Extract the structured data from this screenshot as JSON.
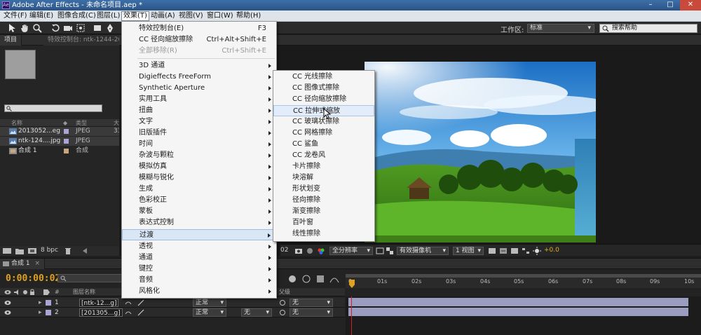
{
  "window": {
    "title": "Adobe After Effects - 未命名项目.aep *",
    "icon_text": "Ae",
    "buttons": [
      "–",
      "□",
      "✕"
    ]
  },
  "menubar": {
    "items": [
      "文件(F)",
      "编辑(E)",
      "图像合成(C)",
      "图层(L)",
      "效果(T)",
      "动画(A)",
      "视图(V)",
      "窗口(W)",
      "帮助(H)"
    ],
    "active_index": 4
  },
  "toolbar": {
    "workspace_label": "工作区:",
    "workspace_value": "标准",
    "search_placeholder": "搜索帮助"
  },
  "project_panel": {
    "tabs": [
      "项目",
      "特效控制台: ntk-1244-267"
    ],
    "columns": [
      "名称",
      "类型",
      "大"
    ],
    "items": [
      {
        "name": "2013052...eg",
        "type": "JPEG",
        "size": "33",
        "color": "#a9a5d6"
      },
      {
        "name": "ntk-124....jpg",
        "type": "JPEG",
        "size": "",
        "color": "#a9a5d6"
      },
      {
        "name": "合成 1",
        "type": "合成",
        "size": "",
        "color": "#c9a67e"
      }
    ],
    "bpc": "8 bpc"
  },
  "effect_menu": {
    "items": [
      {
        "label": "特效控制台(E)",
        "shortcut": "F3",
        "disabled": false,
        "submenu": false
      },
      {
        "label": "CC 径向缩放擦除",
        "shortcut": "Ctrl+Alt+Shift+E",
        "disabled": false,
        "submenu": false
      },
      {
        "label": "全部移除(R)",
        "shortcut": "Ctrl+Shift+E",
        "disabled": true,
        "submenu": false
      },
      {
        "label": "3D 通道",
        "shortcut": "",
        "disabled": false,
        "submenu": true
      },
      {
        "label": "Digieffects FreeForm",
        "shortcut": "",
        "disabled": false,
        "submenu": true
      },
      {
        "label": "Synthetic Aperture",
        "shortcut": "",
        "disabled": false,
        "submenu": true
      },
      {
        "label": "实用工具",
        "shortcut": "",
        "disabled": false,
        "submenu": true
      },
      {
        "label": "扭曲",
        "shortcut": "",
        "disabled": false,
        "submenu": true
      },
      {
        "label": "文字",
        "shortcut": "",
        "disabled": false,
        "submenu": true
      },
      {
        "label": "旧版插件",
        "shortcut": "",
        "disabled": false,
        "submenu": true
      },
      {
        "label": "时间",
        "shortcut": "",
        "disabled": false,
        "submenu": true
      },
      {
        "label": "杂波与颗粒",
        "shortcut": "",
        "disabled": false,
        "submenu": true
      },
      {
        "label": "模拟仿真",
        "shortcut": "",
        "disabled": false,
        "submenu": true
      },
      {
        "label": "模糊与锐化",
        "shortcut": "",
        "disabled": false,
        "submenu": true
      },
      {
        "label": "生成",
        "shortcut": "",
        "disabled": false,
        "submenu": true
      },
      {
        "label": "色彩校正",
        "shortcut": "",
        "disabled": false,
        "submenu": true
      },
      {
        "label": "蒙板",
        "shortcut": "",
        "disabled": false,
        "submenu": true
      },
      {
        "label": "表达式控制",
        "shortcut": "",
        "disabled": false,
        "submenu": true
      },
      {
        "label": "过渡",
        "shortcut": "",
        "disabled": false,
        "submenu": true
      },
      {
        "label": "透视",
        "shortcut": "",
        "disabled": false,
        "submenu": true
      },
      {
        "label": "通道",
        "shortcut": "",
        "disabled": false,
        "submenu": true
      },
      {
        "label": "键控",
        "shortcut": "",
        "disabled": false,
        "submenu": true
      },
      {
        "label": "音频",
        "shortcut": "",
        "disabled": false,
        "submenu": true
      },
      {
        "label": "风格化",
        "shortcut": "",
        "disabled": false,
        "submenu": true
      }
    ],
    "highlighted_index": 18
  },
  "transition_submenu": {
    "items": [
      "CC 光线擦除",
      "CC 图像式擦除",
      "CC 径向缩放擦除",
      "CC 拉伸式缩放",
      "CC 玻璃状擦除",
      "CC 网格擦除",
      "CC 鲨鱼",
      "CC 龙卷风",
      "卡片擦除",
      "块溶解",
      "形状划变",
      "径向擦除",
      "渐变擦除",
      "百叶窗",
      "线性擦除"
    ],
    "highlighted_index": 3
  },
  "viewer": {
    "zoom_value": "全分辨率",
    "camera_value": "有效摄像机",
    "view_value": "1 视图",
    "exposure_value": "+0.0",
    "timecode_short": "02"
  },
  "timeline": {
    "tab_label": "合成 1",
    "timecode": "0:00:00:02",
    "column_label": "图层名称",
    "mode_header": "父级",
    "ruler_ticks": [
      "0s",
      "01s",
      "02s",
      "03s",
      "04s",
      "05s",
      "06s",
      "07s",
      "08s",
      "09s",
      "10s"
    ],
    "layers": [
      {
        "num": "1",
        "name": "[ntk-12...g]",
        "mode": "正常",
        "parent": "无"
      },
      {
        "num": "2",
        "name": "[201305...g]",
        "mode": "正常",
        "trkmat": "无",
        "parent": "无"
      }
    ]
  },
  "colors": {
    "accent_timecode": "#e0a020",
    "menu_highlight": "#d8e6f6",
    "label_image": "#a9a5d6",
    "label_comp": "#c9a67e"
  }
}
